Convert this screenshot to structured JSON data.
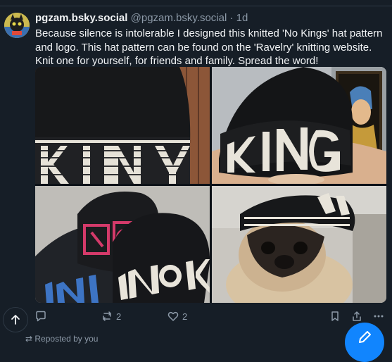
{
  "post": {
    "display_name": "pgzam.bsky.social",
    "handle": "@pgzam.bsky.social",
    "separator": "·",
    "time": "1d",
    "text": "Because silence is intolerable I designed this knitted 'No Kings' hat pattern and logo. This hat pattern can be found on the 'Ravelry' knitting website. Knit one for yourself, for friends and family. Spread the word!",
    "images": [
      {
        "alt": "black knitted hat with white NO KINGS lettering band"
      },
      {
        "alt": "woman wearing black knitted KINGS hat in front of painting"
      },
      {
        "alt": "three knitted NO KINGS hats in blue, red and white"
      },
      {
        "alt": "pug wearing black and white knitted hat"
      }
    ]
  },
  "actions": {
    "reply": {
      "icon": "reply-icon",
      "count": ""
    },
    "repost": {
      "icon": "repost-icon",
      "count": "2"
    },
    "like": {
      "icon": "heart-icon",
      "count": "2"
    },
    "bookmark": {
      "icon": "bookmark-icon"
    },
    "share": {
      "icon": "share-icon"
    },
    "more": {
      "icon": "more-icon"
    }
  },
  "footer": {
    "reposted_by": "Reposted by you"
  },
  "colors": {
    "background": "#161e27",
    "text": "#f1f3f5",
    "muted": "#8d9aa8",
    "accent": "#1185fe"
  }
}
